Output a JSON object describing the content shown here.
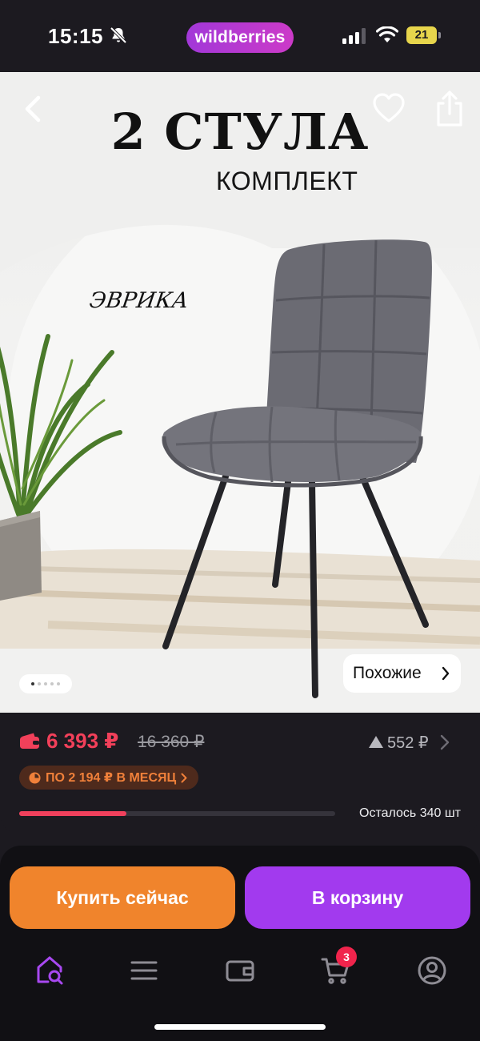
{
  "status_bar": {
    "time": "15:15",
    "brand": "wildberries",
    "battery": "21"
  },
  "product_image": {
    "title": "2 СТУЛА",
    "subtitle": "КОМПЛЕКТ",
    "model_name": "ЭВРИКА",
    "slides_total": 5,
    "slide_current": 1
  },
  "similar": {
    "label": "Похожие"
  },
  "price": {
    "current": "6 393 ₽",
    "old": "16 360 ₽",
    "reviews_delta": "552 ₽",
    "installment": "ПО 2 194 ₽ В МЕСЯЦ"
  },
  "stock": {
    "label": "Осталось 340 шт",
    "fill_fraction": 0.34
  },
  "actions": {
    "buy_now": "Купить сейчас",
    "add_to_cart": "В корзину"
  },
  "tab_bar": {
    "cart_count": "3",
    "colors": {
      "active": "#a848f0",
      "inactive": "#8e8c94"
    }
  },
  "colors": {
    "price": "#f2405a",
    "buy_now": "#f0842c",
    "add_to_cart": "#a23aee",
    "installment_text": "#f0803a"
  }
}
